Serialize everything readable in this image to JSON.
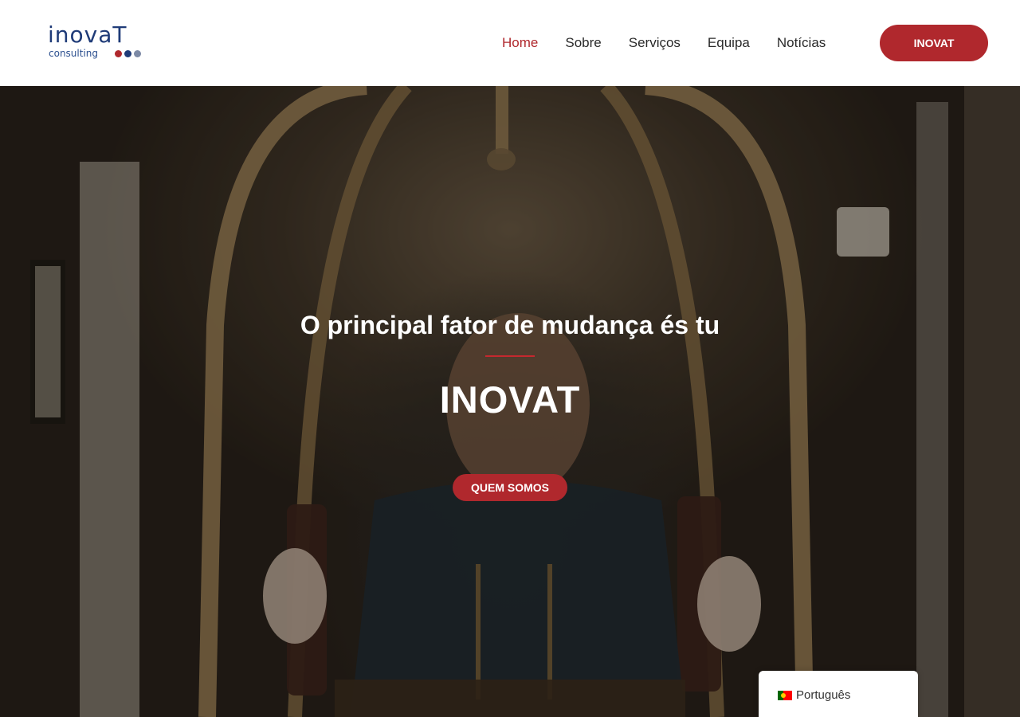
{
  "logo": {
    "word": "inovaT",
    "sub": "consulting",
    "dot_colors": [
      "#b0282d",
      "#1f3b78",
      "#7d8aa6"
    ]
  },
  "nav": {
    "items": [
      {
        "label": "Home",
        "active": true
      },
      {
        "label": "Sobre",
        "active": false
      },
      {
        "label": "Serviços",
        "active": false
      },
      {
        "label": "Equipa",
        "active": false
      },
      {
        "label": "Notícias",
        "active": false
      }
    ],
    "cta_label": "INOVAT"
  },
  "hero": {
    "subtitle": "O principal fator de mudança és tu",
    "title": "INOVAT",
    "button_label": "QUEM SOMOS"
  },
  "language": {
    "flag_icon": "portugal-flag-icon",
    "label": "Português"
  },
  "colors": {
    "accent": "#b0282d",
    "brand_blue": "#1f3b78",
    "nav_text": "#2a2a2a"
  }
}
